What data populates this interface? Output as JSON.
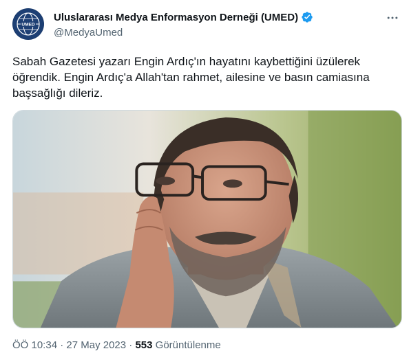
{
  "tweet": {
    "display_name": "Uluslararası Medya Enformasyon Derneği (UMED)",
    "handle": "@MedyaUmed",
    "avatar_text": "UMED",
    "text": "Sabah Gazetesi yazarı Engin Ardıç'ın hayatını kaybettiğini üzülerek\nöğrendik. Engin Ardıç'a Allah'tan rahmet, ailesine ve basın camiasına\nbaşsağlığı dileriz.",
    "time": "ÖÖ 10:34",
    "separator": "·",
    "date": "27 May 2023",
    "views_count": "553",
    "views_label": "Görüntülenme"
  },
  "icons": {
    "verified": "verified-badge-icon",
    "more": "more-options-icon"
  },
  "colors": {
    "verified_blue": "#1d9bf0",
    "secondary_text": "#536471",
    "primary_text": "#0f1419"
  }
}
